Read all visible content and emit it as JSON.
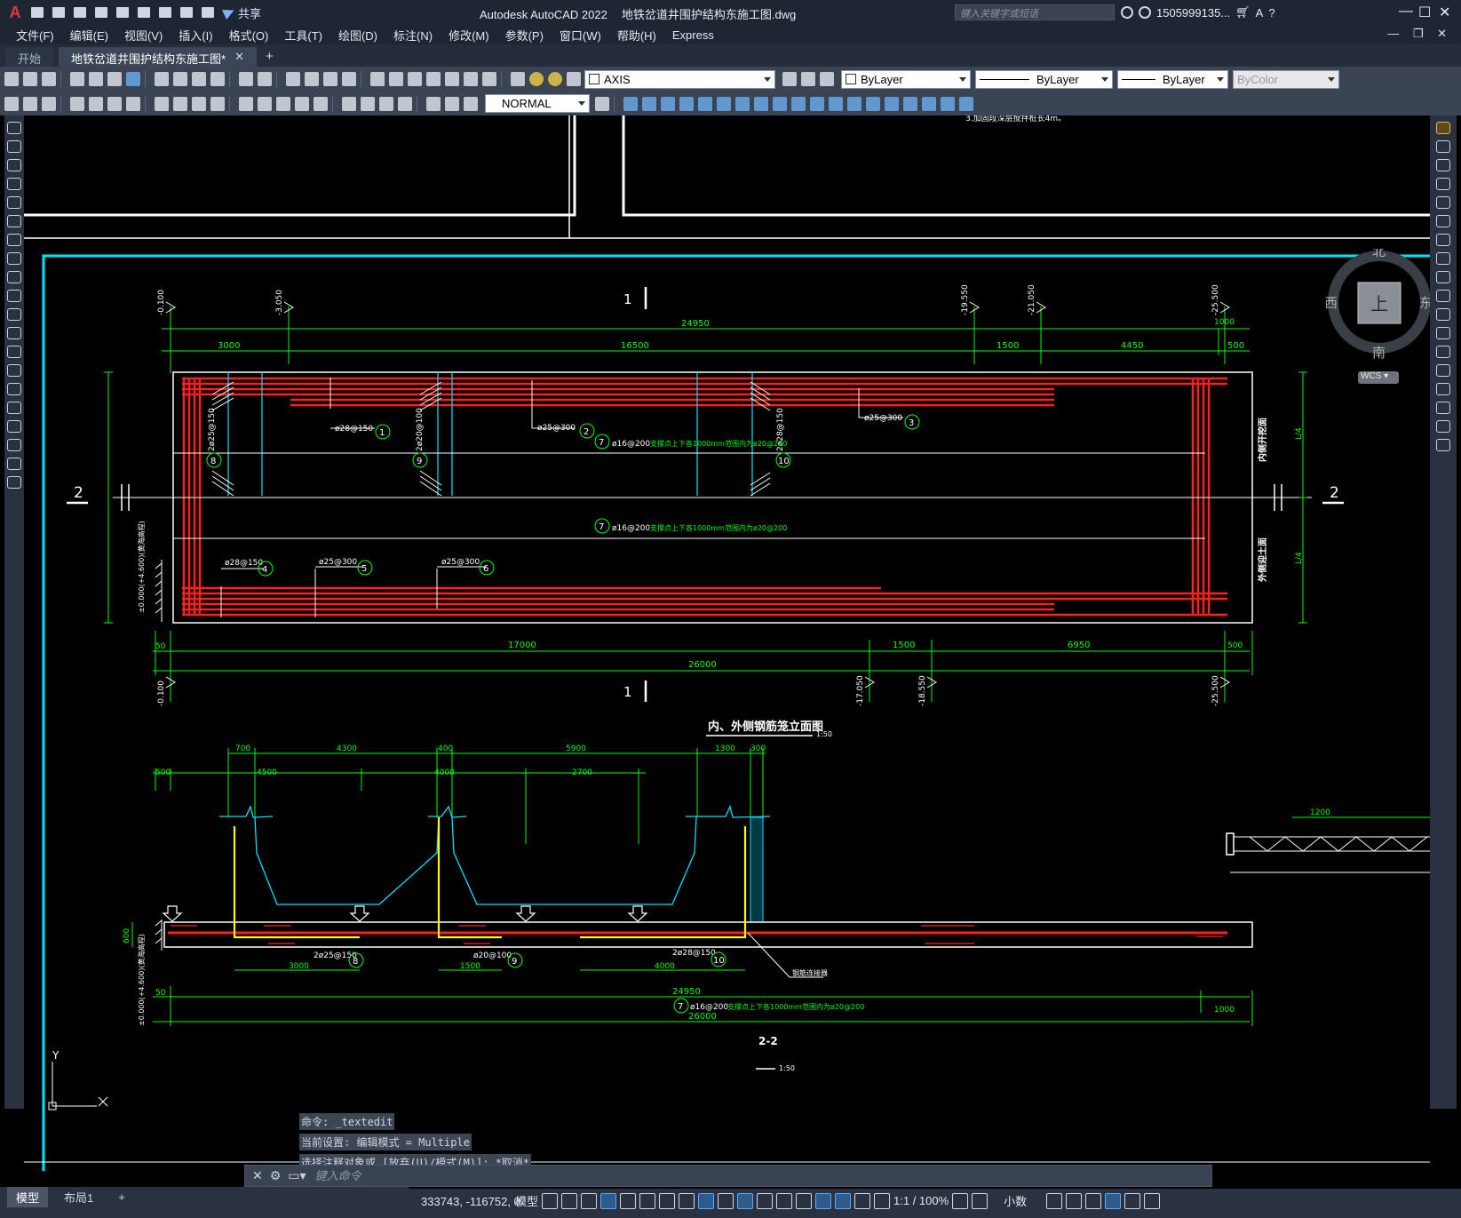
{
  "titlebar": {
    "app_name": "Autodesk AutoCAD 2022",
    "file_name": "地铁岔道井围护结构东施工图.dwg",
    "share_label": "共享",
    "search_placeholder": "键入关键字或短语",
    "user": "1505999135...",
    "window_buttons": [
      "—",
      "☐",
      "✕"
    ]
  },
  "menubar": {
    "items": [
      "文件(F)",
      "编辑(E)",
      "视图(V)",
      "插入(I)",
      "格式(O)",
      "工具(T)",
      "绘图(D)",
      "标注(N)",
      "修改(M)",
      "参数(P)",
      "窗口(W)",
      "帮助(H)",
      "Express"
    ]
  },
  "tabs": {
    "start": "开始",
    "active": "地铁岔道井围护结构东施工图*",
    "close": "✕",
    "add": "+"
  },
  "toolbar": {
    "layer": "AXIS",
    "color": "ByLayer",
    "linetype": "ByLayer",
    "lineweight": "ByLayer",
    "plotstyle": "ByColor",
    "dimstyle": "NORMAL"
  },
  "viewcube": {
    "north": "北",
    "south": "南",
    "east": "东",
    "west": "西",
    "top": "上",
    "wcs": "WCS"
  },
  "drawing": {
    "note_top": "3.加固段深层搅拌桩长4m。",
    "section_marks": [
      "1",
      "1",
      "2",
      "2"
    ],
    "elevations_top": [
      "-0.100",
      "-3.050",
      "-19.550",
      "-21.050",
      "-25.500"
    ],
    "dims_top_total": "24950",
    "dims_top": [
      "3000",
      "16500",
      "1500",
      "4450",
      "500"
    ],
    "dims_top_right": "1000",
    "rebar_labels_upper": [
      "ø28@150",
      "ø25@300",
      "ø25@300"
    ],
    "rebar_nums_upper": [
      "1",
      "2",
      "3"
    ],
    "vert_labels": [
      "2ø25@150",
      "2ø20@100",
      "2ø28@150"
    ],
    "vert_nums": [
      "8",
      "9",
      "10"
    ],
    "stirrup_num": "7",
    "stirrup_text": "ø16@200",
    "stirrup_note": "支撑点上下各1000mm范围内为ø20@200",
    "rebar_labels_lower": [
      "ø28@150",
      "ø25@300",
      "ø25@300"
    ],
    "rebar_nums_lower": [
      "4",
      "5",
      "6"
    ],
    "side_labels": [
      "内侧开挖面",
      "外侧迎土面"
    ],
    "side_dims": [
      "L/4",
      "L/4"
    ],
    "left_elev_label": "±0.000(+4.600)(黄海高程)",
    "dims_bottom": [
      "50",
      "17000",
      "1500",
      "6950",
      "500"
    ],
    "dims_bottom_total": "26000",
    "elevations_bottom": [
      "-0.100",
      "-17.050",
      "-18.550",
      "-25.500"
    ],
    "title1": "内、外侧钢筋笼立面图",
    "scale1": "1:50",
    "sec2_dims_top": [
      "700",
      "4300",
      "400",
      "5900",
      "1300",
      "300"
    ],
    "sec2_dims_mid": [
      "500",
      "4500",
      "4000",
      "2700"
    ],
    "sec2_height": "600",
    "sec2_labels": [
      "2ø25@150",
      "ø20@100",
      "2ø28@150"
    ],
    "sec2_nums": [
      "8",
      "9",
      "10"
    ],
    "sec2_dims_low": [
      "3000",
      "1500",
      "4000"
    ],
    "connector": "钢筋连接器",
    "sec2_dims_bottom": [
      "50",
      "24950",
      "26000",
      "1000"
    ],
    "title2": "2-2",
    "scale2": "1:50",
    "side_dim_right": "1200",
    "axis_y": "Y"
  },
  "command": {
    "history": [
      "命令: _textedit",
      "当前设置: 编辑模式 = Multiple",
      "选择注释对象或 [放弃(U)/模式(M)]: *取消*"
    ],
    "placeholder": "键入命令"
  },
  "status": {
    "layouts": [
      "模型",
      "布局1"
    ],
    "add_layout": "+",
    "coords": "333743, -116752, 0",
    "model": "模型",
    "annotation_scale": "1:1 / 100%",
    "units": "小数"
  },
  "colors": {
    "red": "#ff2020",
    "green": "#00ff00",
    "cyan": "#00e5ff",
    "yellow": "#ffff00",
    "white": "#ffffff"
  }
}
